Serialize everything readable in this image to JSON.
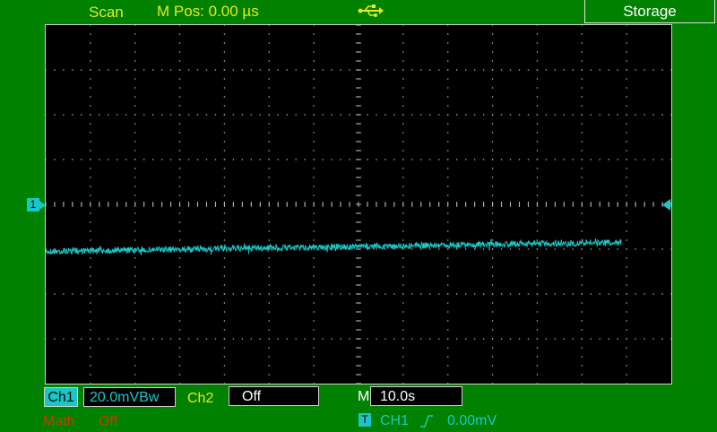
{
  "header": {
    "mode": "Scan",
    "mpos_label": "M Pos: 0.00 µs",
    "usb_icon": "usb-icon",
    "storage_label": "Storage"
  },
  "screen": {
    "grid_divisions": {
      "horizontal": 14,
      "vertical": 8
    },
    "ch1_marker": "1",
    "trigger_marker": "trigger-level-arrow-icon",
    "trace": {
      "channel": "CH1",
      "start_level_div": -1.05,
      "end_level_div": -0.85,
      "record_fraction": 0.92,
      "color": "#18c8c8"
    }
  },
  "footer": {
    "ch1": {
      "label": "Ch1",
      "value": "20.0mVBw"
    },
    "ch2": {
      "label": "Ch2",
      "value": "Off"
    },
    "math": {
      "label": "Math",
      "value": "Off"
    },
    "timebase": {
      "label": "M",
      "value": "10.0s"
    },
    "trigger": {
      "icon": "T",
      "source": "CH1",
      "edge_icon": "rising-edge-icon",
      "level": "0.00mV"
    }
  },
  "colors": {
    "background": "#008200",
    "screen": "#000000",
    "grid": "#b8b8b8",
    "ch1": "#18c8c8",
    "header_text": "#e8e820",
    "math": "#c83c00"
  }
}
